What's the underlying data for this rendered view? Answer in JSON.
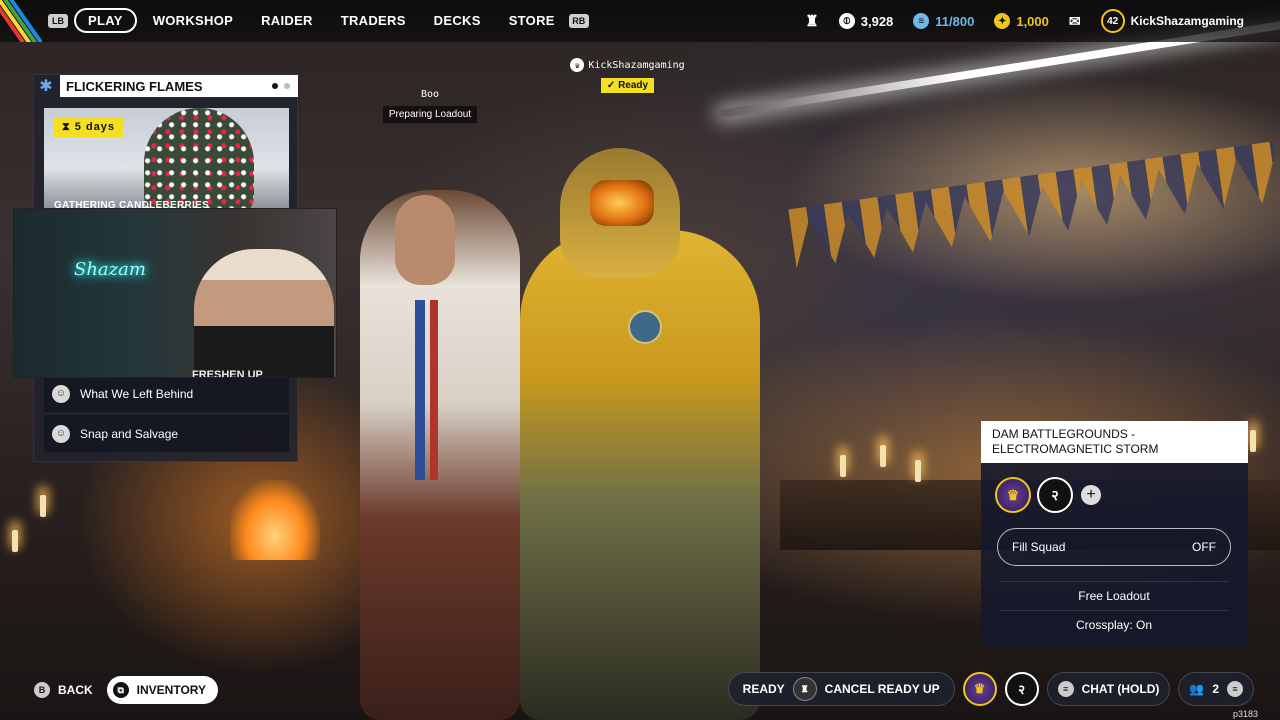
{
  "topbar": {
    "lb_hint": "LB",
    "rb_hint": "RB",
    "nav": [
      {
        "label": "PLAY",
        "active": true
      },
      {
        "label": "WORKSHOP"
      },
      {
        "label": "RAIDER"
      },
      {
        "label": "TRADERS"
      },
      {
        "label": "DECKS"
      },
      {
        "label": "STORE"
      }
    ],
    "stats": {
      "raider_tokens": "3,928",
      "stash": "11/800",
      "coins": "1,000",
      "level": "42",
      "username": "KickShazamgaming"
    }
  },
  "event": {
    "title": "FLICKERING FLAMES",
    "timer": "5 days",
    "subtitle": "GATHERING CANDLEBERRIES",
    "quests": [
      "What We Left Behind",
      "Snap and Salvage"
    ]
  },
  "webcam": {
    "neon_sign": "Shazam",
    "shirt_text": "FRESHEN UP"
  },
  "players": {
    "p1": {
      "name": "Boo",
      "status": "Preparing Loadout"
    },
    "p2": {
      "name": "KickShazamgaming",
      "status": "Ready"
    }
  },
  "squad": {
    "map_line1": "DAM BATTLEGROUNDS -",
    "map_line2": "ELECTROMAGNETIC STORM",
    "fill_squad_label": "Fill Squad",
    "fill_squad_value": "OFF",
    "free_loadout": "Free Loadout",
    "crossplay": "Crossplay: On"
  },
  "bottom": {
    "back_hint": "B",
    "back_label": "BACK",
    "inventory_label": "INVENTORY",
    "ready_label": "READY",
    "cancel_label": "CANCEL READY UP",
    "chat_label": "CHAT (HOLD)",
    "party_count": "2",
    "session_id": "p3183"
  },
  "colors": {
    "accent_yellow": "#f4df23",
    "panel_bg": "#20222e",
    "level_ring": "#f0c419"
  }
}
